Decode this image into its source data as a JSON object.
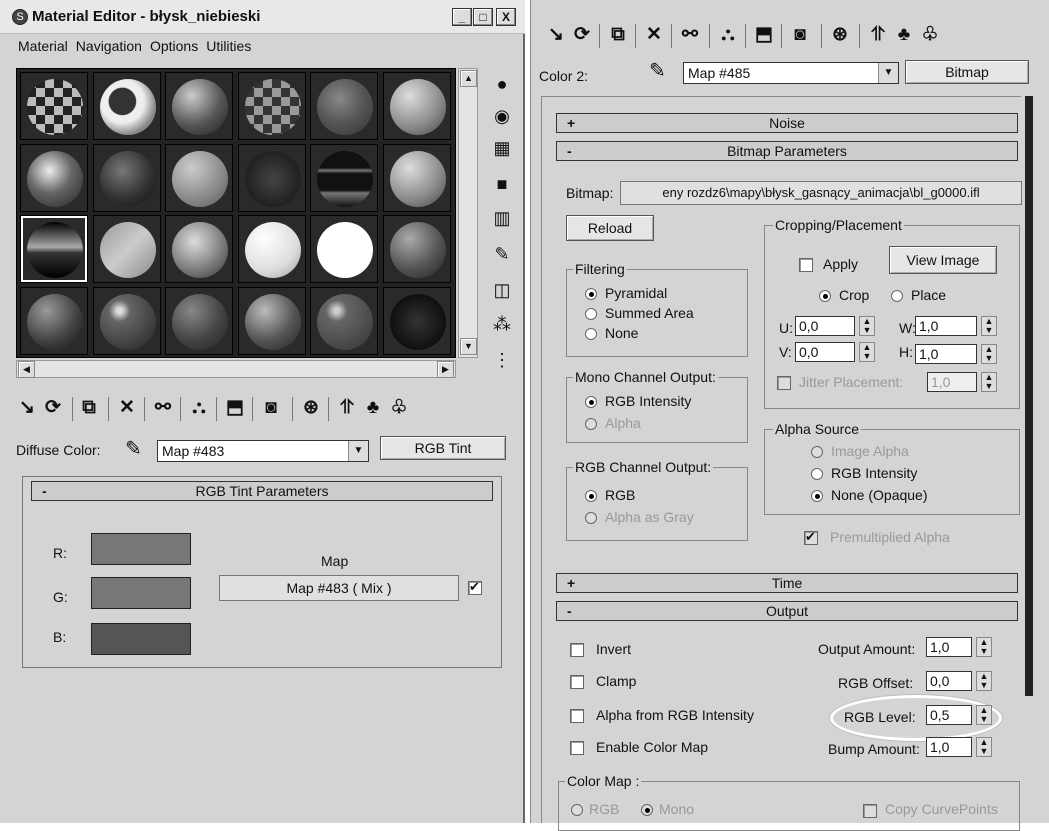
{
  "left": {
    "title": "Material Editor - błysk_niebieski",
    "window_buttons": [
      "_",
      "□",
      "X"
    ],
    "menu": [
      "Material",
      "Navigation",
      "Options",
      "Utilities"
    ],
    "diffuse_label": "Diffuse Color:",
    "map_combo": "Map #483",
    "map_type_button": "RGB Tint",
    "rollout_toggle": "-",
    "rollout_title": "RGB Tint Parameters",
    "r_label": "R:",
    "g_label": "G:",
    "b_label": "B:",
    "map_label": "Map",
    "map_button": "Map #483  ( Mix )",
    "swatch_colors": [
      "#777777",
      "#777777",
      "#555555"
    ]
  },
  "right": {
    "color2_label": "Color 2:",
    "map_combo": "Map #485",
    "map_type_button": "Bitmap",
    "noise_title": "Noise",
    "noise_toggle": "+",
    "bitmap_params_title": "Bitmap Parameters",
    "bitmap_params_toggle": "-",
    "bitmap_label": "Bitmap:",
    "bitmap_path": "eny rozdz6\\mapy\\błysk_gasnący_animacja\\bl_g0000.ifl",
    "reload": "Reload",
    "cropping": {
      "title": "Cropping/Placement",
      "apply": "Apply",
      "view_image": "View Image",
      "crop": "Crop",
      "place": "Place",
      "u_label": "U:",
      "u_value": "0,0",
      "v_label": "V:",
      "v_value": "0,0",
      "w_label": "W:",
      "w_value": "1,0",
      "h_label": "H:",
      "h_value": "1,0",
      "jitter_label": "Jitter Placement:",
      "jitter_value": "1,0"
    },
    "filtering": {
      "title": "Filtering",
      "options": [
        "Pyramidal",
        "Summed Area",
        "None"
      ]
    },
    "mono": {
      "title": "Mono Channel Output:",
      "options": [
        "RGB Intensity",
        "Alpha"
      ]
    },
    "rgbout": {
      "title": "RGB Channel Output:",
      "options": [
        "RGB",
        "Alpha as Gray"
      ]
    },
    "alpha_source": {
      "title": "Alpha Source",
      "options": [
        "Image Alpha",
        "RGB Intensity",
        "None (Opaque)"
      ]
    },
    "premultiplied": "Premultiplied Alpha",
    "time_title": "Time",
    "time_toggle": "+",
    "output_title": "Output",
    "output_toggle": "-",
    "output": {
      "invert": "Invert",
      "clamp": "Clamp",
      "alpha_from_rgb": "Alpha from RGB Intensity",
      "enable_color_map": "Enable Color Map",
      "output_amount_label": "Output Amount:",
      "output_amount": "1,0",
      "rgb_offset_label": "RGB Offset:",
      "rgb_offset": "0,0",
      "rgb_level_label": "RGB Level:",
      "rgb_level": "0,5",
      "bump_amount_label": "Bump Amount:",
      "bump_amount": "1,0"
    },
    "color_map": {
      "title": "Color Map :",
      "rgb": "RGB",
      "mono": "Mono",
      "copy_curve": "Copy CurvePoints"
    }
  }
}
